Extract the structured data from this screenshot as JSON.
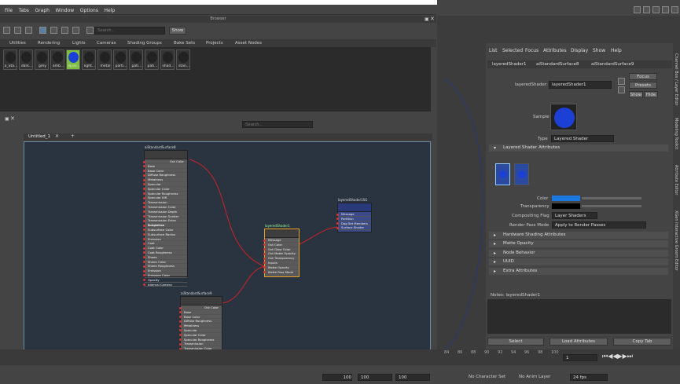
{
  "menu": [
    "File",
    "Tabs",
    "Graph",
    "Window",
    "Options",
    "Help"
  ],
  "browser": {
    "title": "Browser",
    "search_placeholder": "Search...",
    "show": "Show",
    "tabs": [
      "Utilities",
      "Rendering",
      "Lights",
      "Cameras",
      "Shading Groups",
      "Bake Sets",
      "Projects",
      "Asset Nodes"
    ],
    "swatches": [
      "a_Sta...",
      "dark...",
      "grey",
      "amb...",
      "layer...",
      "light...",
      "metal",
      "parti...",
      "pati...",
      "pati...",
      "shad...",
      "stan..."
    ]
  },
  "node_editor": {
    "tab": "Untitled_1",
    "search_placeholder": "Search...",
    "nodes": {
      "n1": {
        "title": "aiStandardSurface8",
        "out": "Out Color",
        "rows": [
          "Base",
          "Base Color",
          "Diffuse Roughness",
          "Metalness",
          "Specular",
          "Specular Color",
          "Specular Roughness",
          "Specular IOR",
          "Transmission",
          "Transmission Color",
          "Transmission Depth",
          "Transmission Scatter",
          "Transmission Extra Roughness",
          "Subsurface",
          "Subsurface Color",
          "Subsurface Radius",
          "Emission",
          "Coat",
          "Coat Color",
          "Coat Roughness",
          "Sheen",
          "Sheen Color",
          "Sheen Roughness",
          "Emission",
          "Emission Color",
          "Opacity",
          "Internal Camera"
        ]
      },
      "n2": {
        "title": "layeredShader1",
        "rows": [
          "Message",
          "Out Color",
          "Out Glow Color",
          "Out Matte Opacity",
          "Out Transparency",
          "Inputs",
          "Matte Opacity",
          "Matte Pass Mode"
        ]
      },
      "n3": {
        "title": "layeredShader1SG",
        "rows": [
          "Message",
          "Partition",
          "Dag Set Members",
          "Surface Shader"
        ]
      },
      "n4": {
        "title": "aiStandardSurface9",
        "out": "Out Color",
        "rows": [
          "Base",
          "Base Color",
          "Diffuse Roughness",
          "Metalness",
          "Specular",
          "Specular Color",
          "Specular Roughness",
          "Transmission",
          "Transmission Color"
        ]
      }
    }
  },
  "ae": {
    "menu": [
      "List",
      "Selected",
      "Focus",
      "Attributes",
      "Display",
      "Show",
      "Help"
    ],
    "tabs": [
      "layeredShader1",
      "aiStandardSurface8",
      "aiStandardSurface9"
    ],
    "shader_label": "layeredShader:",
    "shader_value": "layeredShader1",
    "focus": "Focus",
    "presets": "Presets",
    "show": "Show",
    "hide": "Hide",
    "sample_label": "Sample",
    "type_label": "Type",
    "type_value": "Layered Shader",
    "section_main": "Layered Shader Attributes",
    "color_label": "Color",
    "transparency_label": "Transparency",
    "comp_label": "Compositing Flag",
    "comp_value": "Layer Shaders",
    "render_label": "Render Pass Mode",
    "render_value": "Apply to Render Passes",
    "sections": [
      "Hardware Shading Attributes",
      "Matte Opacity",
      "Node Behavior",
      "UUID",
      "Extra Attributes"
    ],
    "notes": "Notes:  layeredShader1",
    "select": "Select",
    "load": "Load Attributes",
    "copy": "Copy Tab"
  },
  "sidetabs": [
    "Channel Box / Layer Editor",
    "Modeling Toolkit",
    "Attribute Editor",
    "XGen Interactive Groom Editor"
  ],
  "timeline": {
    "ticks": [
      "84",
      "86",
      "88",
      "90",
      "92",
      "94",
      "96",
      "98",
      "100"
    ],
    "frame": "1"
  },
  "range": {
    "v1": "100",
    "v2": "100",
    "v3": "100",
    "char": "No Character Set",
    "anim": "No Anim Layer",
    "fps": "24 fps"
  }
}
